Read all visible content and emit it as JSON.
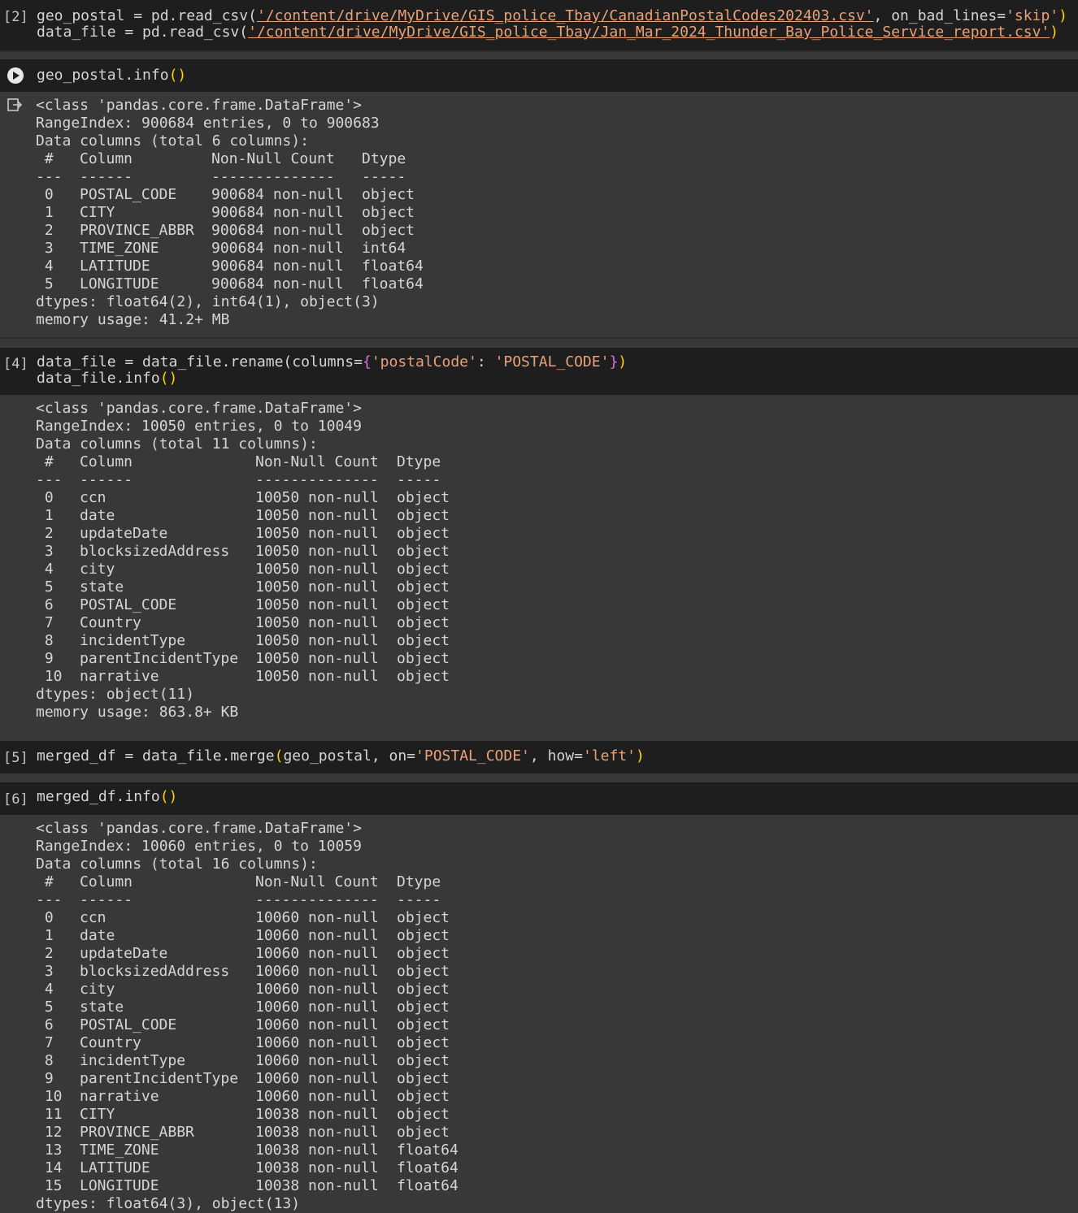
{
  "cell2": {
    "exec": "[2]",
    "line1_pre": "geo_postal = pd.read_csv(",
    "line1_str": "'/content/drive/MyDrive/GIS_police_Tbay/CanadianPostalCodes202403.csv'",
    "line1_mid": ", on_bad_lines=",
    "line1_str2": "'skip'",
    "line1_post": ")",
    "line2_pre": "data_file = pd.read_csv(",
    "line2_str": "'/content/drive/MyDrive/GIS_police_Tbay/Jan_Mar_2024_Thunder_Bay_Police_Service_report.csv'",
    "line2_post": ")"
  },
  "cell3": {
    "code": "geo_postal.info",
    "parens": "()",
    "out_header": [
      "<class 'pandas.core.frame.DataFrame'>",
      "RangeIndex: 900684 entries, 0 to 900683",
      "Data columns (total 6 columns):"
    ],
    "th": {
      "idx": " #",
      "col": "Column",
      "cnt": "Non-Null Count",
      "dt": "Dtype"
    },
    "tsep": {
      "idx": "---",
      "col": "------",
      "cnt": "--------------",
      "dt": "-----"
    },
    "rows": [
      {
        "i": " 0",
        "c": "POSTAL_CODE",
        "n": "900684 non-null",
        "d": "object"
      },
      {
        "i": " 1",
        "c": "CITY",
        "n": "900684 non-null",
        "d": "object"
      },
      {
        "i": " 2",
        "c": "PROVINCE_ABBR",
        "n": "900684 non-null",
        "d": "object"
      },
      {
        "i": " 3",
        "c": "TIME_ZONE",
        "n": "900684 non-null",
        "d": "int64"
      },
      {
        "i": " 4",
        "c": "LATITUDE",
        "n": "900684 non-null",
        "d": "float64"
      },
      {
        "i": " 5",
        "c": "LONGITUDE",
        "n": "900684 non-null",
        "d": "float64"
      }
    ],
    "footer": [
      "dtypes: float64(2), int64(1), object(3)",
      "memory usage: 41.2+ MB"
    ]
  },
  "cell4": {
    "exec": "[4]",
    "line1_pre": "data_file = data_file.rename(columns=",
    "line1_brace_open": "{",
    "line1_key": "'postalCode'",
    "line1_colon": ": ",
    "line1_val": "'POSTAL_CODE'",
    "line1_brace_close": "}",
    "line1_close": ")",
    "line2": "data_file.info",
    "line2_parens": "()",
    "out_header": [
      "<class 'pandas.core.frame.DataFrame'>",
      "RangeIndex: 10050 entries, 0 to 10049",
      "Data columns (total 11 columns):"
    ],
    "th": {
      "idx": " #",
      "col": "Column",
      "cnt": "Non-Null Count",
      "dt": "Dtype"
    },
    "tsep": {
      "idx": "---",
      "col": "------",
      "cnt": "--------------",
      "dt": "-----"
    },
    "rows": [
      {
        "i": " 0",
        "c": "ccn",
        "n": "10050 non-null",
        "d": "object"
      },
      {
        "i": " 1",
        "c": "date",
        "n": "10050 non-null",
        "d": "object"
      },
      {
        "i": " 2",
        "c": "updateDate",
        "n": "10050 non-null",
        "d": "object"
      },
      {
        "i": " 3",
        "c": "blocksizedAddress",
        "n": "10050 non-null",
        "d": "object"
      },
      {
        "i": " 4",
        "c": "city",
        "n": "10050 non-null",
        "d": "object"
      },
      {
        "i": " 5",
        "c": "state",
        "n": "10050 non-null",
        "d": "object"
      },
      {
        "i": " 6",
        "c": "POSTAL_CODE",
        "n": "10050 non-null",
        "d": "object"
      },
      {
        "i": " 7",
        "c": "Country",
        "n": "10050 non-null",
        "d": "object"
      },
      {
        "i": " 8",
        "c": "incidentType",
        "n": "10050 non-null",
        "d": "object"
      },
      {
        "i": " 9",
        "c": "parentIncidentType",
        "n": "10050 non-null",
        "d": "object"
      },
      {
        "i": " 10",
        "c": "narrative",
        "n": "10050 non-null",
        "d": "object"
      }
    ],
    "footer": [
      "dtypes: object(11)",
      "memory usage: 863.8+ KB"
    ]
  },
  "cell5": {
    "exec": "[5]",
    "pre": "merged_df = data_file.merge",
    "paren_open": "(",
    "mid1": "geo_postal, on=",
    "str1": "'POSTAL_CODE'",
    "mid2": ", how=",
    "str2": "'left'",
    "paren_close": ")"
  },
  "cell6": {
    "exec": "[6]",
    "code": "merged_df.info",
    "parens": "()",
    "out_header": [
      "<class 'pandas.core.frame.DataFrame'>",
      "RangeIndex: 10060 entries, 0 to 10059",
      "Data columns (total 16 columns):"
    ],
    "th": {
      "idx": " #",
      "col": "Column",
      "cnt": "Non-Null Count",
      "dt": "Dtype"
    },
    "tsep": {
      "idx": "---",
      "col": "------",
      "cnt": "--------------",
      "dt": "-----"
    },
    "rows": [
      {
        "i": " 0",
        "c": "ccn",
        "n": "10060 non-null",
        "d": "object"
      },
      {
        "i": " 1",
        "c": "date",
        "n": "10060 non-null",
        "d": "object"
      },
      {
        "i": " 2",
        "c": "updateDate",
        "n": "10060 non-null",
        "d": "object"
      },
      {
        "i": " 3",
        "c": "blocksizedAddress",
        "n": "10060 non-null",
        "d": "object"
      },
      {
        "i": " 4",
        "c": "city",
        "n": "10060 non-null",
        "d": "object"
      },
      {
        "i": " 5",
        "c": "state",
        "n": "10060 non-null",
        "d": "object"
      },
      {
        "i": " 6",
        "c": "POSTAL_CODE",
        "n": "10060 non-null",
        "d": "object"
      },
      {
        "i": " 7",
        "c": "Country",
        "n": "10060 non-null",
        "d": "object"
      },
      {
        "i": " 8",
        "c": "incidentType",
        "n": "10060 non-null",
        "d": "object"
      },
      {
        "i": " 9",
        "c": "parentIncidentType",
        "n": "10060 non-null",
        "d": "object"
      },
      {
        "i": " 10",
        "c": "narrative",
        "n": "10060 non-null",
        "d": "object"
      },
      {
        "i": " 11",
        "c": "CITY",
        "n": "10038 non-null",
        "d": "object"
      },
      {
        "i": " 12",
        "c": "PROVINCE_ABBR",
        "n": "10038 non-null",
        "d": "object"
      },
      {
        "i": " 13",
        "c": "TIME_ZONE",
        "n": "10038 non-null",
        "d": "float64"
      },
      {
        "i": " 14",
        "c": "LATITUDE",
        "n": "10038 non-null",
        "d": "float64"
      },
      {
        "i": " 15",
        "c": "LONGITUDE",
        "n": "10038 non-null",
        "d": "float64"
      }
    ],
    "footer": [
      "dtypes: float64(3), object(13)"
    ]
  },
  "icons": {
    "run": "play-circle-icon",
    "output": "output-redirect-icon"
  }
}
